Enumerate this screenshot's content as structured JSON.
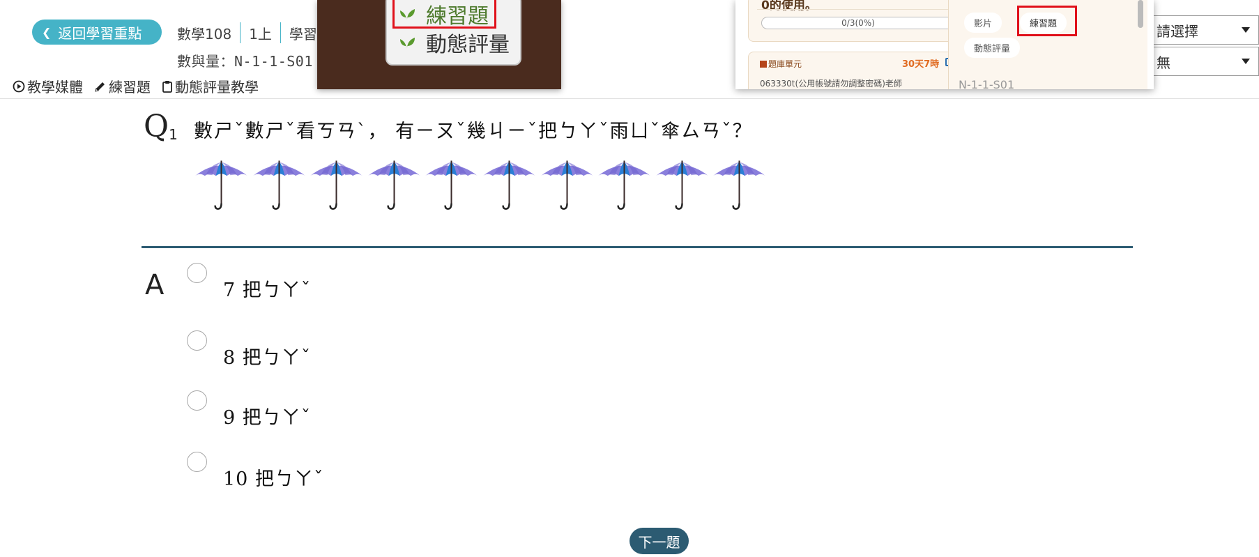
{
  "header": {
    "back_button": "返回學習重點",
    "breadcrumb": [
      "數學108",
      "1上",
      "學習"
    ],
    "sub_breadcrumb": "數與量：N-1-1-S01",
    "selects": [
      {
        "value": "請選擇"
      },
      {
        "value": "無"
      }
    ]
  },
  "toolbar": {
    "media": "教學媒體",
    "exercise": "練習題",
    "dynamic": "動態評量教學"
  },
  "popup_left": {
    "items": [
      "練習題",
      "動態評量"
    ],
    "highlighted": "練習題"
  },
  "popup_right": {
    "usage_title": "0的使用。",
    "progress_text": "0/3(0%)",
    "progress_fraction": 0,
    "unit_label": "題庫單元",
    "time_left": "30天7時",
    "teacher": "063330t(公用帳號請勿調整密碼)老師",
    "tags": [
      "影片",
      "練習題",
      "動態評量"
    ],
    "highlighted_tag": "練習題",
    "code": "N-1-1-S01"
  },
  "question": {
    "label": "Q",
    "number": "1",
    "text": "數ㄕˇ數ㄕˇ看ㄎㄢˋ， 有ㄧㄡˇ幾ㄐㄧˇ把ㄅㄚˇ雨ㄩˇ傘ㄙㄢˇ？",
    "umbrella_count": 10
  },
  "answer": {
    "label": "A",
    "options": [
      "7 把ㄅㄚˇ",
      "8 把ㄅㄚˇ",
      "9 把ㄅㄚˇ",
      "10 把ㄅㄚˇ"
    ]
  },
  "next_button": "下一題",
  "colors": {
    "accent": "#45b3c7",
    "navy": "#2c5b72",
    "highlight_red": "#e0101a",
    "umbrella_canopy": "#8a7fdc",
    "umbrella_center": "#2a7fd6"
  }
}
